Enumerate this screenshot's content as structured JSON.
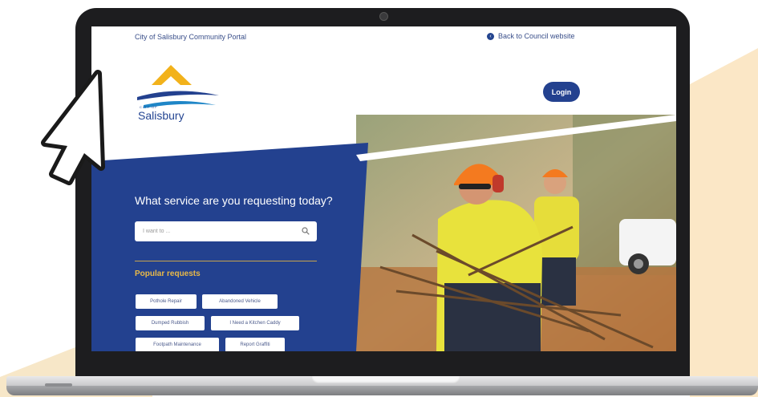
{
  "topbar": {
    "portal_name": "City of Salisbury Community Portal",
    "back_link": "Back to Council website"
  },
  "logo": {
    "small_text": "CITY OF",
    "name": "Salisbury"
  },
  "header": {
    "login_label": "Login"
  },
  "hero": {
    "headline": "What service are you requesting today?",
    "search_placeholder": "I want to ...",
    "popular_title": "Popular requests",
    "popular_requests": [
      "Pothole Repair",
      "Abandoned Vehicle",
      "Dumped Rubbish",
      "I Need a Kitchen Caddy",
      "Footpath Maintenance",
      "Report Graffiti"
    ]
  },
  "colors": {
    "brand_blue": "#23418f",
    "accent_gold": "#e9b948",
    "laptop_frame": "#1d1d1f"
  },
  "icons": {
    "back": "arrow-left-circle-icon",
    "search": "search-icon",
    "cursor": "mouse-pointer-icon"
  }
}
